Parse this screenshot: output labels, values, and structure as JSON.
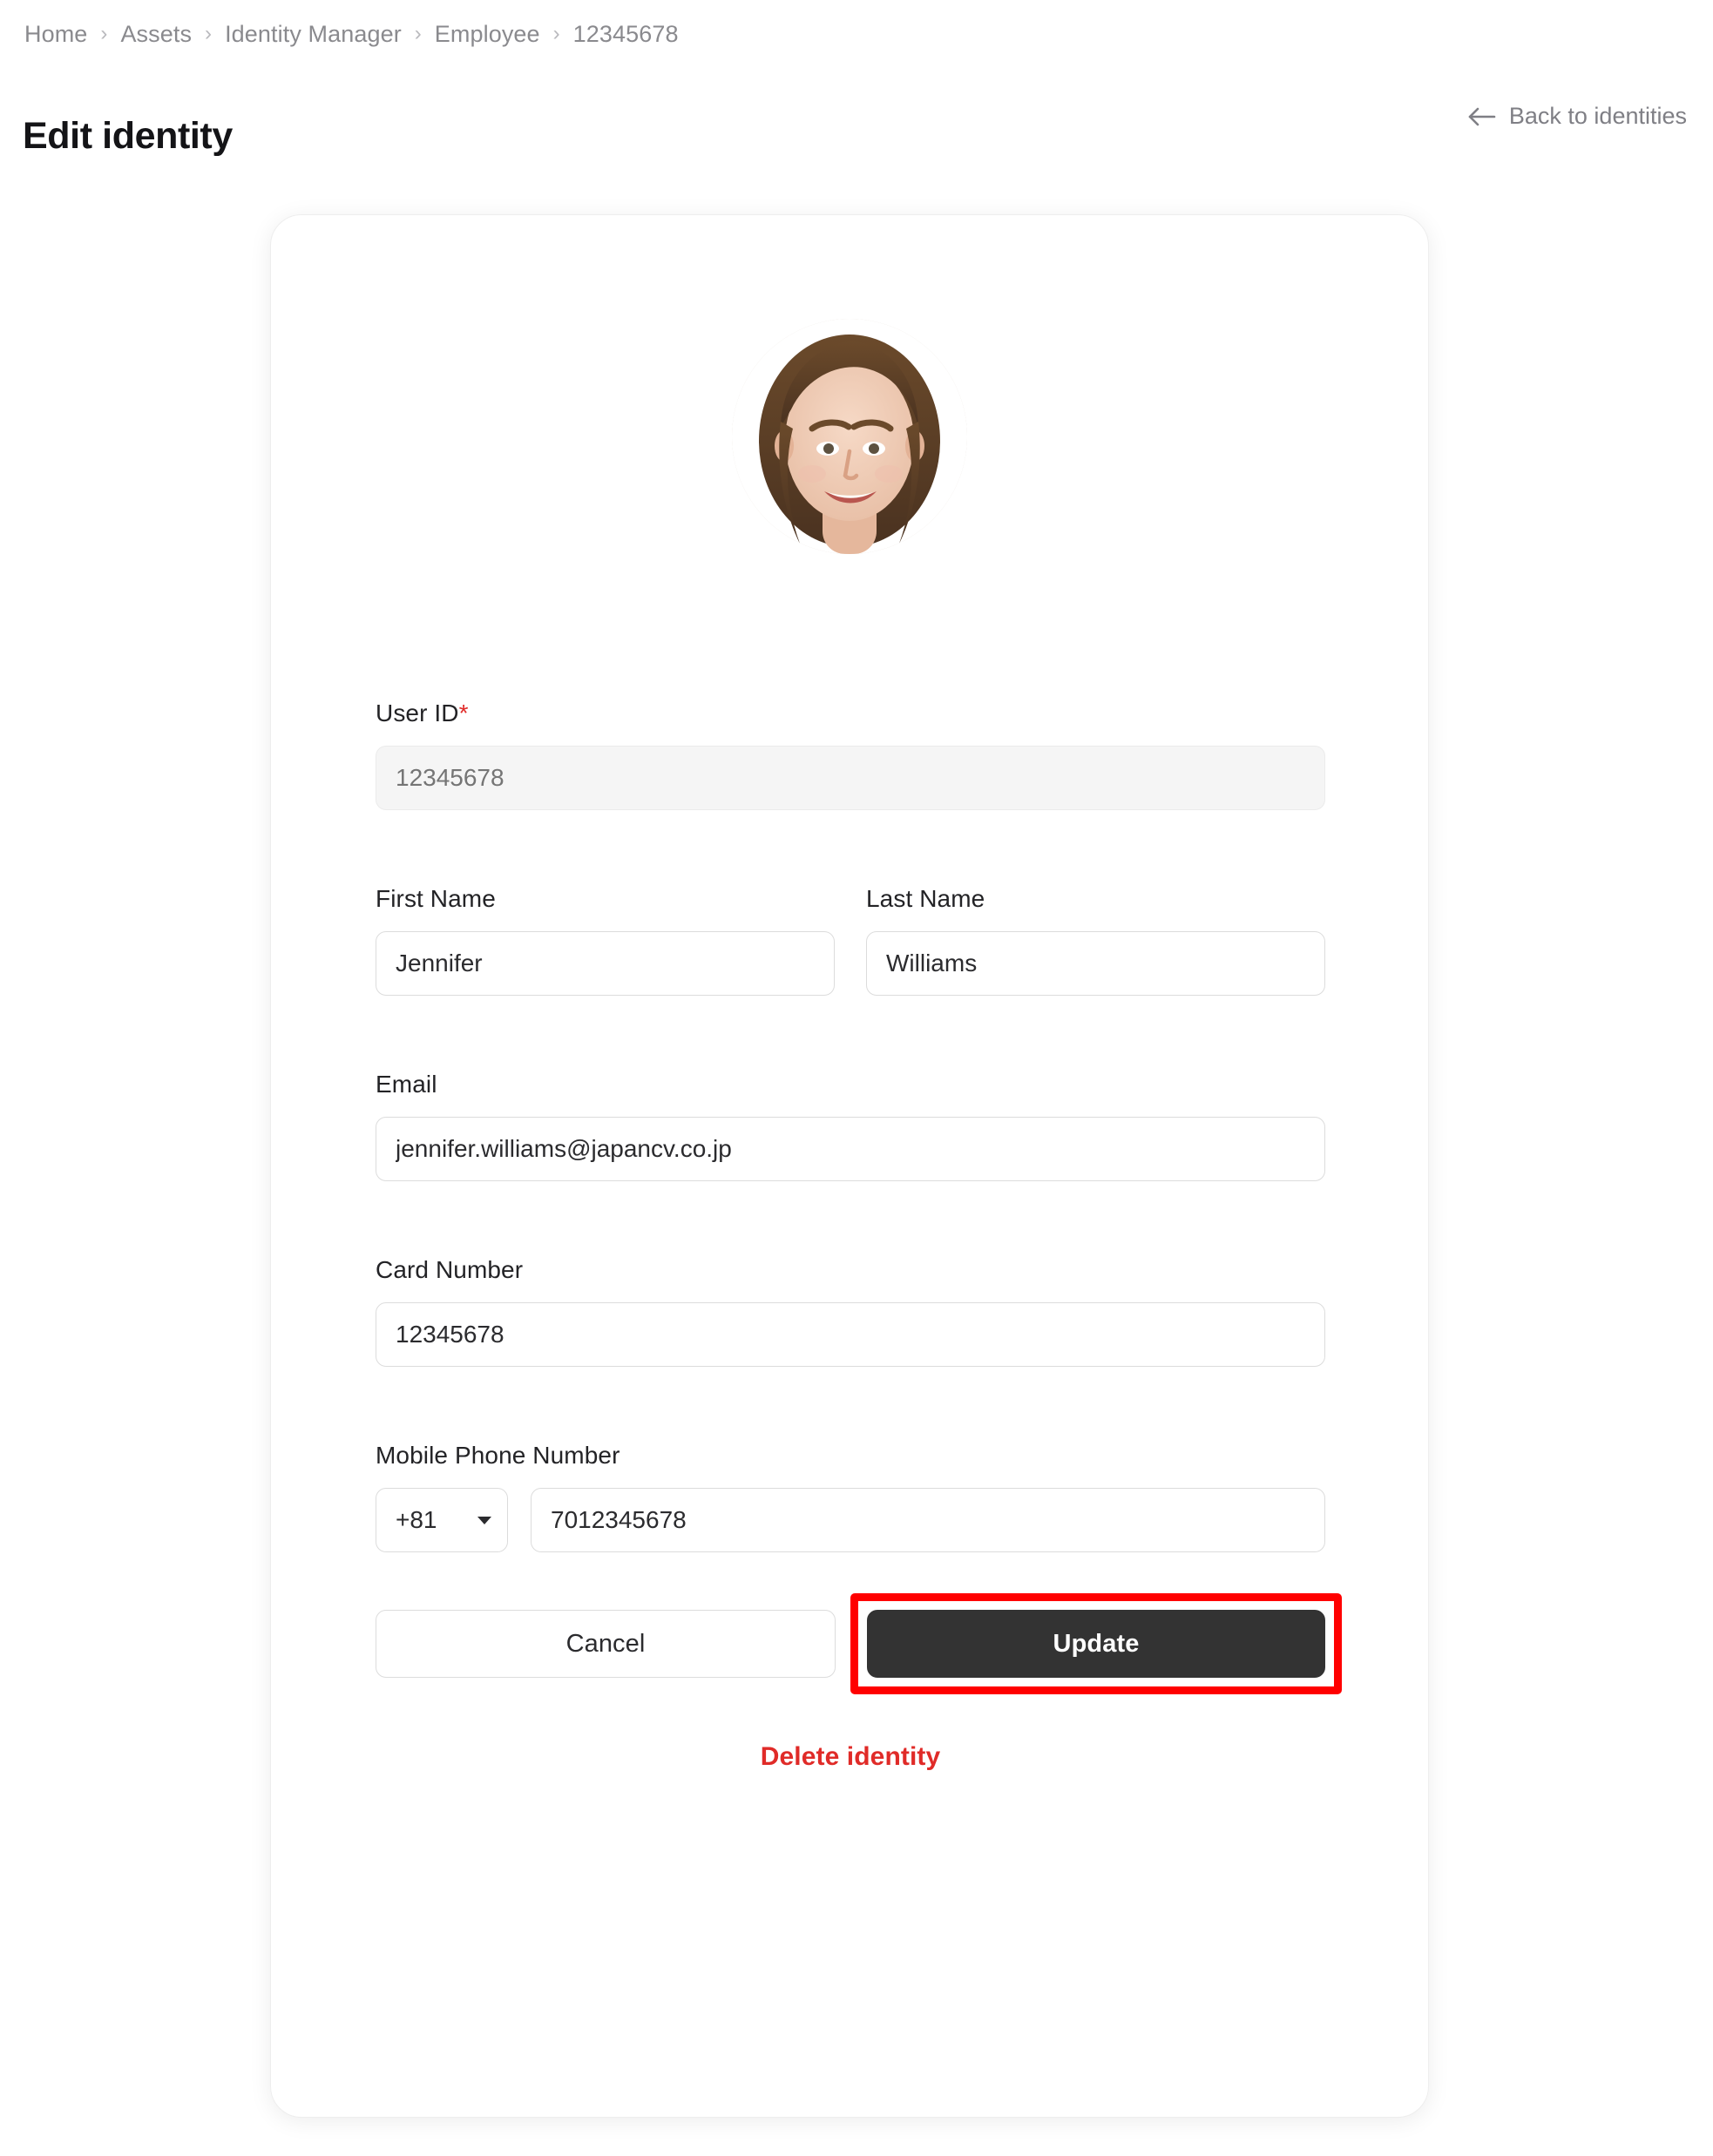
{
  "breadcrumb": {
    "separator": "›",
    "items": [
      {
        "label": "Home"
      },
      {
        "label": "Assets"
      },
      {
        "label": "Identity Manager"
      },
      {
        "label": "Employee"
      },
      {
        "label": "12345678"
      }
    ]
  },
  "header": {
    "title": "Edit identity",
    "back_label": "Back to identities",
    "back_icon": "arrow-left-icon"
  },
  "card": {
    "avatar_alt": "Employee profile photo"
  },
  "form": {
    "user_id": {
      "label": "User ID",
      "required_marker": "*",
      "value": "",
      "placeholder": "12345678",
      "disabled": true
    },
    "first_name": {
      "label": "First Name",
      "value": "Jennifer",
      "placeholder": "First Name"
    },
    "last_name": {
      "label": "Last Name",
      "value": "Williams",
      "placeholder": "Last Name"
    },
    "email": {
      "label": "Email",
      "value": "jennifer.williams@japancv.co.jp",
      "placeholder": "Email"
    },
    "card_number": {
      "label": "Card Number",
      "value": "12345678",
      "placeholder": "Card Number"
    },
    "mobile_phone": {
      "label": "Mobile Phone Number",
      "country_code": "+81",
      "value": "7012345678",
      "placeholder": "Mobile Phone Number"
    }
  },
  "actions": {
    "cancel_label": "Cancel",
    "update_label": "Update",
    "delete_label": "Delete identity"
  },
  "colors": {
    "accent_danger": "#e02b28",
    "primary_button": "#333333",
    "highlight_annotation": "#ff0000",
    "muted_text": "#8a8a8e"
  }
}
